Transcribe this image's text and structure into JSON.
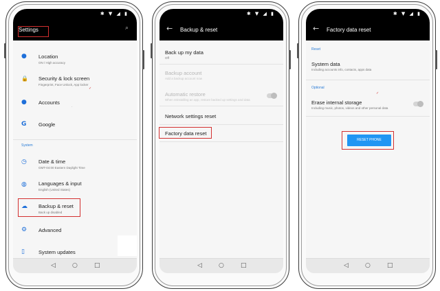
{
  "nav_glyphs": {
    "back": "◁",
    "home": "○",
    "recents": "□"
  },
  "status_icons": "✱ ▼ ◢ ▮",
  "phone1": {
    "title": "Settings",
    "search_icon": "⌕",
    "items": [
      {
        "icon": "location-icon",
        "glyph": "●",
        "title": "Location",
        "subtitle": "ON / High accuracy"
      },
      {
        "icon": "lock-icon",
        "glyph": "🔒",
        "title": "Security & lock screen",
        "subtitle": "Fingerprint, Face Unlock, App locker"
      },
      {
        "icon": "account-icon",
        "glyph": "●",
        "title": "Accounts",
        "subtitle": ""
      },
      {
        "icon": "google-icon",
        "glyph": "G",
        "title": "Google",
        "subtitle": ""
      }
    ],
    "section_system": "System",
    "system_items": [
      {
        "icon": "clock-icon",
        "glyph": "◷",
        "title": "Date & time",
        "subtitle": "GMT-04:00 Eastern Daylight Time"
      },
      {
        "icon": "globe-icon",
        "glyph": "◍",
        "title": "Languages & input",
        "subtitle": "English (United States)"
      },
      {
        "icon": "cloud-upload-icon",
        "glyph": "☁",
        "title": "Backup & reset",
        "subtitle": "Back up disabled"
      },
      {
        "icon": "gear-icon",
        "glyph": "⚙",
        "title": "Advanced",
        "subtitle": ""
      },
      {
        "icon": "phone-update-icon",
        "glyph": "▯",
        "title": "System updates",
        "subtitle": ""
      }
    ]
  },
  "phone2": {
    "title": "Backup & reset",
    "back_icon": "←",
    "items": [
      {
        "title": "Back up my data",
        "subtitle": "Off",
        "disabled": false
      },
      {
        "title": "Backup account",
        "subtitle": "Add a backup account now",
        "disabled": true
      },
      {
        "title": "Automatic restore",
        "subtitle": "When reinstalling an app, restore backed up settings and data",
        "disabled": true
      },
      {
        "title": "Network settings reset",
        "subtitle": "",
        "disabled": false
      },
      {
        "title": "Factory data reset",
        "subtitle": "",
        "disabled": false
      }
    ]
  },
  "phone3": {
    "title": "Factory data reset",
    "back_icon": "←",
    "section_reset": "Reset",
    "system_data": {
      "title": "System data",
      "subtitle": "Including accounts info, contacts, apps data"
    },
    "section_optional": "Optional",
    "erase": {
      "title": "Erase internal storage",
      "subtitle": "Including music, photos, videos and other personal data"
    },
    "button": "RESET PHONE"
  }
}
